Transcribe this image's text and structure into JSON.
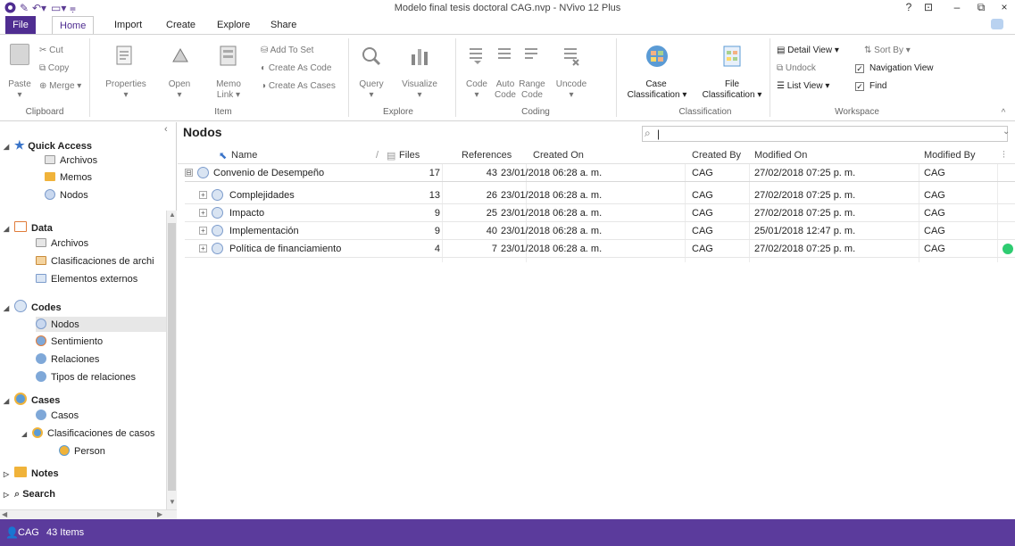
{
  "app": {
    "title": "Modelo final tesis doctoral CAG.nvp - NVivo 12 Plus",
    "window_controls": [
      "?",
      "⊡",
      "–",
      "⧉",
      "×"
    ]
  },
  "ribbon_tabs": [
    "File",
    "Home",
    "Import",
    "Create",
    "Explore",
    "Share"
  ],
  "ribbon": {
    "clipboard": {
      "paste": "Paste",
      "cut": "Cut",
      "copy": "Copy",
      "merge": "Merge",
      "label": "Clipboard"
    },
    "item": {
      "properties": "Properties",
      "open": "Open",
      "memo_link": "Memo",
      "memo_link2": "Link",
      "add_to_set": "Add To Set",
      "create_as_code": "Create As Code",
      "create_as_cases": "Create As Cases",
      "label": "Item"
    },
    "explore": {
      "query": "Query",
      "visualize": "Visualize",
      "label": "Explore"
    },
    "coding": {
      "code": "Code",
      "auto_code": "Auto",
      "auto_code2": "Code",
      "range_code": "Range",
      "range_code2": "Code",
      "uncode": "Uncode",
      "label": "Coding"
    },
    "classification": {
      "case": "Case",
      "case2": "Classification",
      "file": "File",
      "file2": "Classification",
      "label": "Classification"
    },
    "workspace": {
      "detail_view": "Detail View",
      "sort_by": "Sort By",
      "undock": "Undock",
      "navigation_view": "Navigation View",
      "list_view": "List View",
      "find": "Find",
      "label": "Workspace"
    }
  },
  "nav": {
    "quick_access": {
      "label": "Quick Access",
      "items": [
        "Archivos",
        "Memos",
        "Nodos"
      ]
    },
    "data": {
      "label": "Data",
      "items": [
        "Archivos",
        "Clasificaciones de archi",
        "Elementos externos"
      ]
    },
    "codes": {
      "label": "Codes",
      "items": [
        "Nodos",
        "Sentimiento",
        "Relaciones",
        "Tipos de relaciones"
      ]
    },
    "cases": {
      "label": "Cases",
      "items": [
        "Casos",
        "Clasificaciones de casos",
        "Person"
      ]
    },
    "notes": {
      "label": "Notes"
    },
    "search": {
      "label": "Search"
    }
  },
  "detail": {
    "title": "Nodos",
    "search_placeholder": "",
    "columns": [
      "Name",
      "Files",
      "References",
      "Created On",
      "Created By",
      "Modified On",
      "Modified By"
    ],
    "rows": [
      {
        "name": "Convenio de Desempeño",
        "files": "17",
        "references": "43",
        "created_on": "23/01/2018 06:28 a. m.",
        "created_by": "CAG",
        "modified_on": "27/02/2018 07:25 p. m.",
        "modified_by": "CAG",
        "expander": "⊟"
      },
      {
        "name": "Complejidades",
        "files": "13",
        "references": "26",
        "created_on": "23/01/2018 06:28 a. m.",
        "created_by": "CAG",
        "modified_on": "27/02/2018 07:25 p. m.",
        "modified_by": "CAG",
        "expander": "+"
      },
      {
        "name": "Impacto",
        "files": "9",
        "references": "25",
        "created_on": "23/01/2018 06:28 a. m.",
        "created_by": "CAG",
        "modified_on": "27/02/2018 07:25 p. m.",
        "modified_by": "CAG",
        "expander": "+"
      },
      {
        "name": "Implementación",
        "files": "9",
        "references": "40",
        "created_on": "23/01/2018 06:28 a. m.",
        "created_by": "CAG",
        "modified_on": "25/01/2018 12:47 p. m.",
        "modified_by": "CAG",
        "expander": "+"
      },
      {
        "name": "Política de financiamiento",
        "files": "4",
        "references": "7",
        "created_on": "23/01/2018 06:28 a. m.",
        "created_by": "CAG",
        "modified_on": "27/02/2018 07:25 p. m.",
        "modified_by": "CAG",
        "expander": "+"
      }
    ]
  },
  "status": {
    "user": "CAG",
    "items": "43 Items"
  },
  "colors": {
    "accent": "#4f2d91",
    "status_bar": "#5b3b9c",
    "green_dot": "#2ecc71"
  }
}
